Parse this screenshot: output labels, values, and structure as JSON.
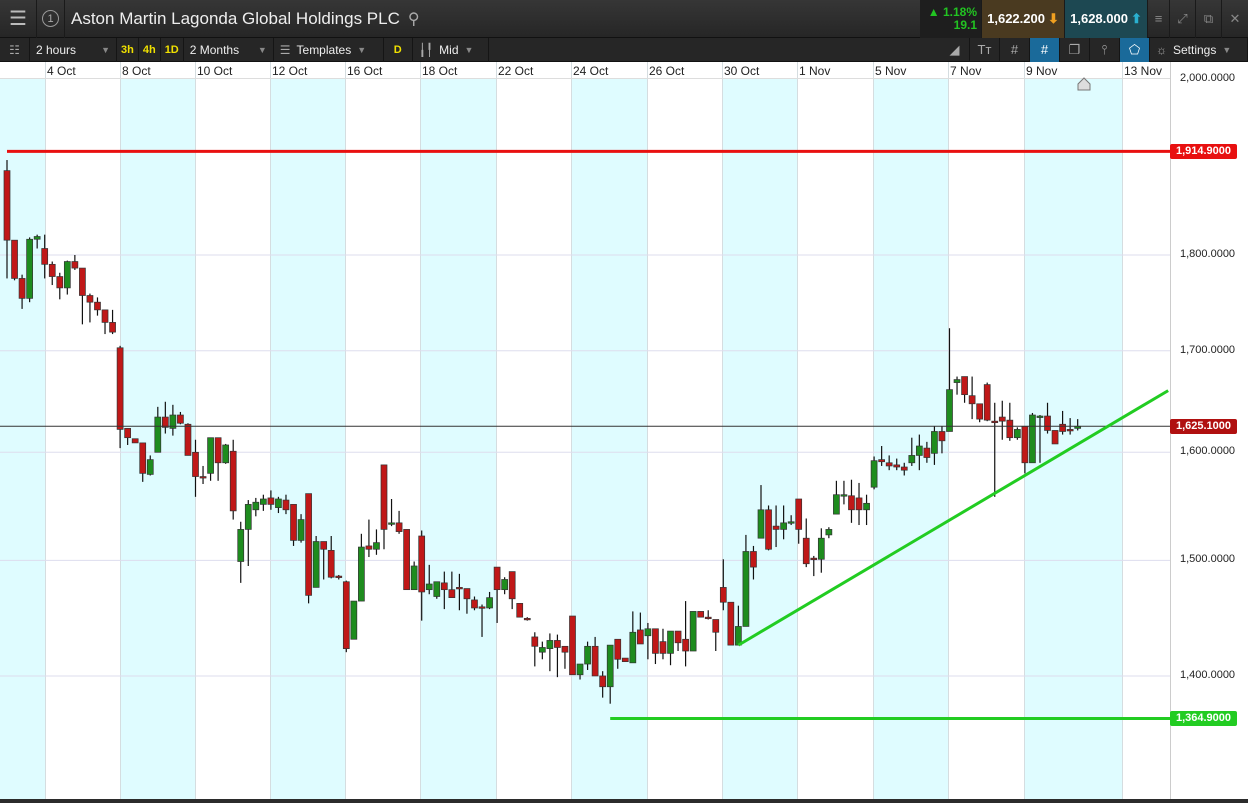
{
  "header": {
    "title": "Aston Martin Lagonda Global Holdings PLC",
    "window_number": "1",
    "change_pct": "▲ 1.18%",
    "change_abs": "19.1",
    "sell_price": "1,622.200",
    "buy_price": "1,628.000"
  },
  "toolbar": {
    "interval": "2 hours",
    "quick_3h": "3h",
    "quick_4h": "4h",
    "quick_1d": "1D",
    "range": "2 Months",
    "templates": "Templates",
    "d_button": "D",
    "price_type": "Mid",
    "settings": "Settings"
  },
  "x_axis": {
    "dates": [
      "4 Oct",
      "8 Oct",
      "10 Oct",
      "12 Oct",
      "16 Oct",
      "18 Oct",
      "22 Oct",
      "24 Oct",
      "26 Oct",
      "30 Oct",
      "1 Nov",
      "5 Nov",
      "7 Nov",
      "9 Nov",
      "13 Nov"
    ]
  },
  "y_axis": {
    "ticks": [
      {
        "v": 2000,
        "label": "2,000.0000"
      },
      {
        "v": 1800,
        "label": "1,800.0000"
      },
      {
        "v": 1700,
        "label": "1,700.0000"
      },
      {
        "v": 1600,
        "label": "1,600.0000"
      },
      {
        "v": 1500,
        "label": "1,500.0000"
      },
      {
        "v": 1400,
        "label": "1,400.0000"
      }
    ]
  },
  "lines": {
    "resistance": {
      "value": 1914.9,
      "label": "1,914.9000",
      "color": "#e81010"
    },
    "support": {
      "value": 1364.9,
      "label": "1,364.9000",
      "color": "#22cc22"
    },
    "current": {
      "value": 1625.1,
      "label": "1,625.1000",
      "color": "#b01010"
    }
  },
  "colors": {
    "up": "#1e8c1e",
    "down": "#c01818",
    "band": "#dffcff"
  },
  "chart_data": {
    "type": "candlestick",
    "interval": "2 hours",
    "trendline": {
      "from_index": 97,
      "from_price": 1426,
      "to_index": 154,
      "to_price": 1660
    },
    "candles": [
      [
        1893,
        1905,
        1775,
        1816
      ],
      [
        1816,
        1816,
        1773,
        1775
      ],
      [
        1775,
        1779,
        1743,
        1754
      ],
      [
        1754,
        1819,
        1750,
        1817
      ],
      [
        1817,
        1822,
        1807,
        1820
      ],
      [
        1807,
        1822,
        1775,
        1790
      ],
      [
        1790,
        1793,
        1768,
        1777
      ],
      [
        1777,
        1781,
        1753,
        1765
      ],
      [
        1765,
        1794,
        1758,
        1793
      ],
      [
        1793,
        1800,
        1784,
        1786
      ],
      [
        1786,
        1786,
        1727,
        1757
      ],
      [
        1757,
        1759,
        1729,
        1750
      ],
      [
        1750,
        1755,
        1736,
        1742
      ],
      [
        1742,
        1742,
        1717,
        1729
      ],
      [
        1729,
        1742,
        1717,
        1719
      ],
      [
        1703,
        1705,
        1604,
        1622
      ],
      [
        1623,
        1623,
        1607,
        1614
      ],
      [
        1613,
        1613,
        1609,
        1609
      ],
      [
        1609,
        1609,
        1572,
        1580
      ],
      [
        1579,
        1597,
        1578,
        1593
      ],
      [
        1600,
        1644,
        1600,
        1634
      ],
      [
        1634,
        1649,
        1618,
        1624
      ],
      [
        1623,
        1646,
        1616,
        1636
      ],
      [
        1636,
        1639,
        1627,
        1628
      ],
      [
        1627,
        1628,
        1597,
        1597
      ],
      [
        1600,
        1612,
        1558,
        1577
      ],
      [
        1577,
        1587,
        1570,
        1576
      ],
      [
        1580,
        1614,
        1573,
        1614
      ],
      [
        1614,
        1614,
        1573,
        1590
      ],
      [
        1590,
        1608,
        1589,
        1607
      ],
      [
        1601,
        1612,
        1537,
        1545
      ],
      [
        1499,
        1535,
        1480,
        1528
      ],
      [
        1528,
        1555,
        1495,
        1551
      ],
      [
        1546,
        1557,
        1540,
        1553
      ],
      [
        1551,
        1560,
        1545,
        1556
      ],
      [
        1557,
        1564,
        1546,
        1551
      ],
      [
        1548,
        1558,
        1543,
        1556
      ],
      [
        1555,
        1560,
        1542,
        1546
      ],
      [
        1551,
        1551,
        1513,
        1518
      ],
      [
        1518,
        1542,
        1516,
        1537
      ],
      [
        1561,
        1561,
        1462,
        1469
      ],
      [
        1476,
        1522,
        1476,
        1517
      ],
      [
        1517,
        1517,
        1483,
        1510
      ],
      [
        1509,
        1522,
        1484,
        1485
      ],
      [
        1486,
        1487,
        1483,
        1485
      ],
      [
        1481,
        1482,
        1420,
        1423
      ],
      [
        1431,
        1464,
        1431,
        1464
      ],
      [
        1464,
        1524,
        1464,
        1512
      ],
      [
        1513,
        1537,
        1503,
        1510
      ],
      [
        1510,
        1528,
        1505,
        1516
      ],
      [
        1588,
        1588,
        1510,
        1528
      ],
      [
        1533,
        1556,
        1531,
        1534
      ],
      [
        1534,
        1545,
        1524,
        1526
      ],
      [
        1528,
        1528,
        1474,
        1474
      ],
      [
        1474,
        1499,
        1474,
        1495
      ],
      [
        1522,
        1527,
        1447,
        1472
      ],
      [
        1474,
        1496,
        1470,
        1479
      ],
      [
        1468,
        1481,
        1466,
        1481
      ],
      [
        1480,
        1490,
        1457,
        1474
      ],
      [
        1474,
        1490,
        1467,
        1467
      ],
      [
        1476,
        1488,
        1456,
        1475
      ],
      [
        1475,
        1475,
        1453,
        1466
      ],
      [
        1465,
        1468,
        1456,
        1458
      ],
      [
        1459,
        1461,
        1433,
        1458
      ],
      [
        1458,
        1472,
        1457,
        1467
      ],
      [
        1494,
        1494,
        1445,
        1474
      ],
      [
        1474,
        1485,
        1470,
        1483
      ],
      [
        1490,
        1490,
        1457,
        1466
      ],
      [
        1462,
        1462,
        1450,
        1450
      ],
      [
        1449,
        1450,
        1447,
        1448
      ],
      [
        1433,
        1437,
        1408,
        1425
      ],
      [
        1420,
        1429,
        1414,
        1424
      ],
      [
        1423,
        1436,
        1404,
        1430
      ],
      [
        1430,
        1435,
        1399,
        1424
      ],
      [
        1425,
        1425,
        1406,
        1420
      ],
      [
        1451,
        1451,
        1401,
        1401
      ],
      [
        1401,
        1410,
        1397,
        1410
      ],
      [
        1410,
        1429,
        1405,
        1425
      ],
      [
        1425,
        1433,
        1400,
        1400
      ],
      [
        1400,
        1404,
        1382,
        1391
      ],
      [
        1391,
        1426,
        1377,
        1426
      ],
      [
        1431,
        1431,
        1406,
        1414
      ],
      [
        1415,
        1415,
        1412,
        1412
      ],
      [
        1411,
        1455,
        1411,
        1437
      ],
      [
        1439,
        1454,
        1427,
        1427
      ],
      [
        1434,
        1445,
        1414,
        1440
      ],
      [
        1440,
        1440,
        1410,
        1419
      ],
      [
        1429,
        1440,
        1414,
        1419
      ],
      [
        1419,
        1438,
        1409,
        1438
      ],
      [
        1438,
        1438,
        1421,
        1428
      ],
      [
        1431,
        1464,
        1408,
        1421
      ],
      [
        1421,
        1455,
        1421,
        1455
      ],
      [
        1455,
        1455,
        1450,
        1450
      ],
      [
        1450,
        1456,
        1448,
        1449
      ],
      [
        1448,
        1448,
        1421,
        1437
      ],
      [
        1476,
        1501,
        1456,
        1463
      ],
      [
        1463,
        1463,
        1426,
        1426
      ],
      [
        1426,
        1460,
        1426,
        1442
      ],
      [
        1442,
        1523,
        1442,
        1508
      ],
      [
        1508,
        1513,
        1483,
        1494
      ],
      [
        1520,
        1569,
        1520,
        1546
      ],
      [
        1546,
        1550,
        1509,
        1510
      ],
      [
        1531,
        1550,
        1512,
        1528
      ],
      [
        1528,
        1550,
        1519,
        1534
      ],
      [
        1535,
        1541,
        1532,
        1535
      ],
      [
        1556,
        1556,
        1515,
        1528
      ],
      [
        1520,
        1538,
        1494,
        1497
      ],
      [
        1502,
        1504,
        1486,
        1501
      ],
      [
        1501,
        1529,
        1489,
        1520
      ],
      [
        1523,
        1530,
        1520,
        1528
      ],
      [
        1542,
        1573,
        1542,
        1560
      ],
      [
        1560,
        1573,
        1551,
        1560
      ],
      [
        1559,
        1574,
        1534,
        1546
      ],
      [
        1557,
        1571,
        1532,
        1546
      ],
      [
        1546,
        1560,
        1532,
        1552
      ],
      [
        1567,
        1596,
        1565,
        1592
      ],
      [
        1593,
        1606,
        1587,
        1591
      ],
      [
        1590,
        1597,
        1583,
        1587
      ],
      [
        1588,
        1594,
        1583,
        1586
      ],
      [
        1586,
        1590,
        1578,
        1583
      ],
      [
        1590,
        1614,
        1587,
        1597
      ],
      [
        1597,
        1617,
        1583,
        1606
      ],
      [
        1604,
        1610,
        1590,
        1595
      ],
      [
        1599,
        1625,
        1588,
        1620
      ],
      [
        1620,
        1625,
        1599,
        1611
      ],
      [
        1620,
        1723,
        1620,
        1661
      ],
      [
        1668,
        1674,
        1656,
        1671
      ],
      [
        1674,
        1674,
        1648,
        1656
      ],
      [
        1655,
        1674,
        1632,
        1647
      ],
      [
        1647,
        1647,
        1629,
        1632
      ],
      [
        1666,
        1668,
        1630,
        1631
      ],
      [
        1630,
        1648,
        1558,
        1629
      ],
      [
        1634,
        1650,
        1612,
        1630
      ],
      [
        1631,
        1648,
        1611,
        1614
      ],
      [
        1614,
        1624,
        1612,
        1622
      ],
      [
        1625,
        1625,
        1580,
        1590
      ],
      [
        1590,
        1638,
        1590,
        1636
      ],
      [
        1634,
        1636,
        1590,
        1635
      ],
      [
        1635,
        1648,
        1618,
        1621
      ],
      [
        1621,
        1621,
        1608,
        1608
      ],
      [
        1627,
        1640,
        1617,
        1620
      ],
      [
        1622,
        1633,
        1617,
        1621
      ],
      [
        1623,
        1632,
        1621,
        1625
      ]
    ]
  }
}
